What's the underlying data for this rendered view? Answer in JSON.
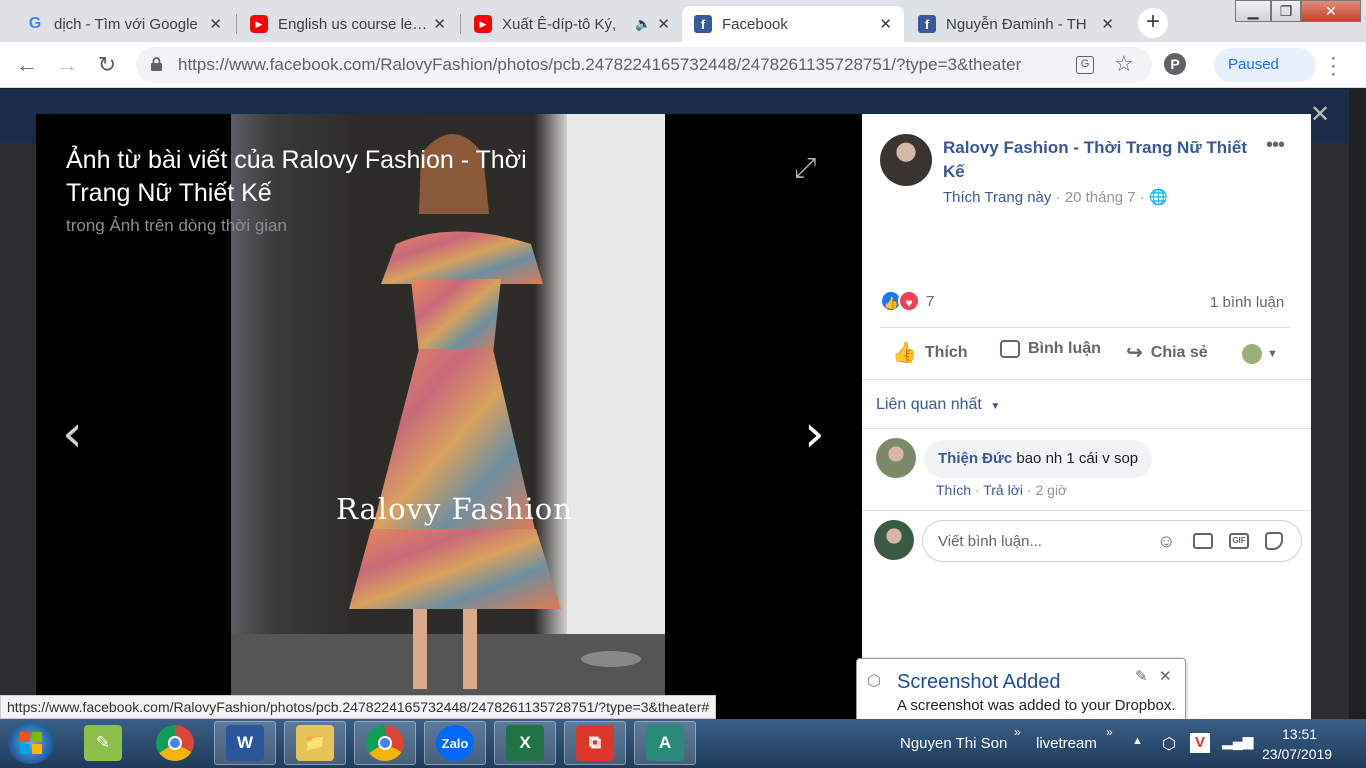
{
  "tabs": [
    {
      "icon": "google-icon",
      "title": "dịch - Tìm với Google",
      "close": "✕"
    },
    {
      "icon": "youtube-icon",
      "title": "English us course leve",
      "close": "✕"
    },
    {
      "icon": "youtube-icon",
      "title": "Xuất Ê-díp-tô Ký,",
      "close": "✕",
      "audio": "🔈"
    },
    {
      "icon": "facebook-icon",
      "title": "Facebook",
      "close": "✕",
      "active": true
    },
    {
      "icon": "facebook-icon",
      "title": "Nguyễn Đaminh - TH",
      "close": "✕"
    }
  ],
  "browser": {
    "url": "https://www.facebook.com/RalovyFashion/photos/pcb.2478224165732448/2478261135728751/?type=3&theater",
    "profile_status": "Paused"
  },
  "viewer": {
    "title": "Ảnh từ bài viết của Ralovy Fashion - Thời Trang Nữ Thiết Kế",
    "subtitle": "trong Ảnh trên dòng thời gian",
    "watermark": "Ralovy Fashion"
  },
  "post": {
    "page_name": "Ralovy Fashion - Thời Trang Nữ Thiết Kế",
    "like_page": "Thích Trang này",
    "date": "20 tháng 7",
    "reaction_count": "7",
    "comment_count": "1 bình luận",
    "actions": {
      "like": "Thích",
      "comment": "Bình luận",
      "share": "Chia sẻ"
    },
    "sort_label": "Liên quan nhất"
  },
  "comment": {
    "author": "Thiện Đức",
    "text": "bao nh 1 cái v sop",
    "like": "Thích",
    "reply": "Trả lời",
    "time": "2 giờ"
  },
  "comment_input": {
    "placeholder": "Viết bình luận..."
  },
  "status_url": "https://www.facebook.com/RalovyFashion/photos/pcb.2478224165732448/2478261135728751/?type=3&theater#",
  "notification": {
    "title": "Screenshot Added",
    "body": "A screenshot was added to your Dropbox."
  },
  "taskbar": {
    "user": "Nguyen Thi Son",
    "toolbar": "livetream",
    "time": "13:51",
    "date": "23/07/2019"
  },
  "colors": {
    "fb_blue": "#385898",
    "fb_dark": "#1b2c4a",
    "accent": "#1a73e8"
  }
}
